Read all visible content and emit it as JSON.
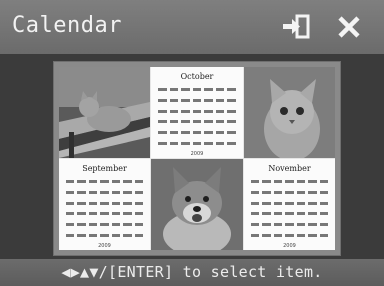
{
  "window": {
    "title": "Calendar",
    "exit_icon": "exit-icon",
    "close_icon": "close-icon"
  },
  "preview": {
    "calendars": [
      {
        "month": "October",
        "year": "2009"
      },
      {
        "month": "September",
        "year": "2009"
      },
      {
        "month": "November",
        "year": "2009"
      }
    ],
    "photos": [
      "cat-on-bench-photo",
      "kitten-photo",
      "shiba-dog-photo"
    ]
  },
  "footer": {
    "hint": "◀▶▲▼/[ENTER] to select item."
  },
  "colors": {
    "title_bar": "#777777",
    "background": "#3b3b3b",
    "text": "#f2f2f2"
  }
}
